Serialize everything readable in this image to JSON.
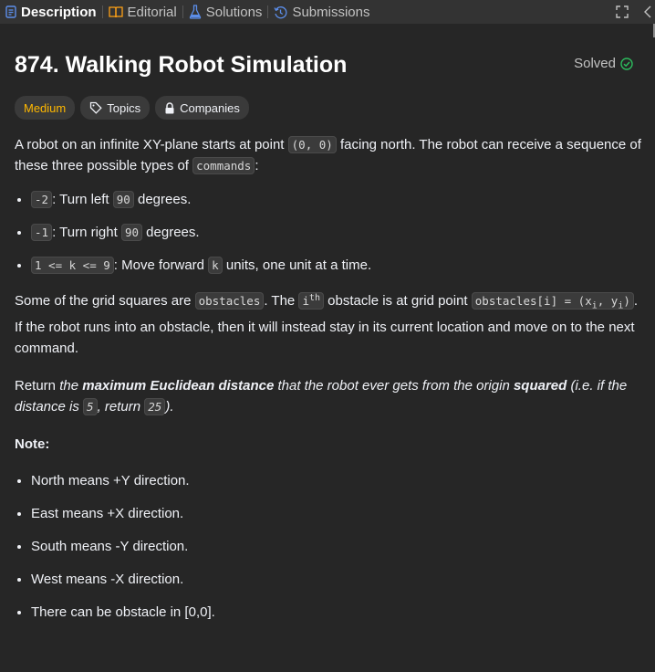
{
  "tabs": [
    {
      "label": "Description",
      "icon": "description-icon",
      "active": true
    },
    {
      "label": "Editorial",
      "icon": "book-icon",
      "active": false
    },
    {
      "label": "Solutions",
      "icon": "flask-icon",
      "active": false
    },
    {
      "label": "Submissions",
      "icon": "history-icon",
      "active": false
    }
  ],
  "problem": {
    "title": "874. Walking Robot Simulation",
    "solved_label": "Solved",
    "difficulty": "Medium",
    "topics_label": "Topics",
    "companies_label": "Companies"
  },
  "description": {
    "intro_1": "A robot on an infinite XY-plane starts at point ",
    "intro_code": "(0, 0)",
    "intro_2": " facing north. The robot can receive a sequence of these three possible types of ",
    "intro_code2": "commands",
    "intro_3": ":",
    "commands": [
      {
        "code": "-2",
        "text": ": Turn left ",
        "code2": "90",
        "text2": " degrees."
      },
      {
        "code": "-1",
        "text": ": Turn right ",
        "code2": "90",
        "text2": " degrees."
      },
      {
        "code": "1 <= k <= 9",
        "text": ": Move forward ",
        "code2": "k",
        "text2": " units, one unit at a time."
      }
    ],
    "obstacles_1": "Some of the grid squares are ",
    "obstacles_code": "obstacles",
    "obstacles_2": ". The ",
    "obstacles_i": "i",
    "obstacles_th": "th",
    "obstacles_3": " obstacle is at grid point ",
    "obstacles_code2": "obstacles[i] = (x",
    "obstacles_sub_i": "i",
    "obstacles_code3": ", y",
    "obstacles_sub_i2": "i",
    "obstacles_code4": ")",
    "obstacles_4": ". If the robot runs into an obstacle, then it will instead stay in its current location and move on to the next command.",
    "return_1": "Return ",
    "return_2": "the ",
    "return_bold": "maximum Euclidean distance",
    "return_3": " that the robot ever gets from the origin ",
    "return_bold2": "squared",
    "return_4": " (i.e. if the distance is ",
    "return_code": "5",
    "return_5": ", return ",
    "return_code2": "25",
    "return_6": ").",
    "note_label": "Note:",
    "notes": [
      "North means +Y direction.",
      "East means +X direction.",
      "South means -Y direction.",
      "West means -X direction.",
      "There can be obstacle in [0,0]."
    ]
  },
  "colors": {
    "accent_medium": "#ffb800",
    "solved_green": "#2cbb5d",
    "background": "#262626"
  }
}
